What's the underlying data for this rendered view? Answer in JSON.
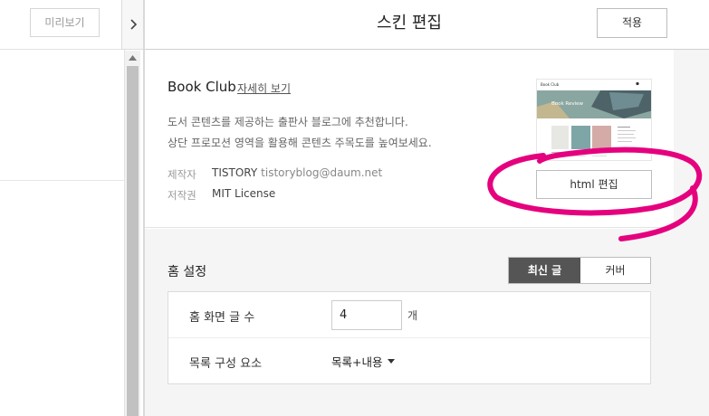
{
  "left_panel": {
    "preview_label": "미리보기"
  },
  "editor": {
    "title": "스킨 편집",
    "apply_label": "적용",
    "skin": {
      "name": "Book Club",
      "detail_link": "자세히 보기",
      "description_line1": "도서 콘텐츠를 제공하는 출판사 블로그에 추천합니다.",
      "description_line2": "상단 프로모션 영역을 활용해 콘텐츠 주목도를 높여보세요.",
      "maker_label": "제작자",
      "maker_name": "TISTORY",
      "maker_email": "tistoryblog@daum.net",
      "license_label": "저작권",
      "license_value": "MIT License",
      "thumbnail": {
        "site_title": "Book Club",
        "banner_text": "Book Review"
      },
      "html_edit_label": "html 편집"
    },
    "home_settings": {
      "title": "홈 설정",
      "tabs": [
        {
          "label": "최신 글",
          "selected": true
        },
        {
          "label": "커버",
          "selected": false
        }
      ],
      "post_count_label": "홈 화면 글 수",
      "post_count_value": "4",
      "post_count_unit": "개",
      "list_components_label": "목록 구성 요소",
      "list_components_value": "목록+내용"
    }
  },
  "icons": {
    "collapse": "chevron-right-icon",
    "scroll_up": "triangle-up-icon",
    "dropdown": "caret-down-icon"
  },
  "colors": {
    "annotation": "#e5007e",
    "selected_tab_bg": "#555555",
    "settings_bg": "#f5f5f5"
  }
}
